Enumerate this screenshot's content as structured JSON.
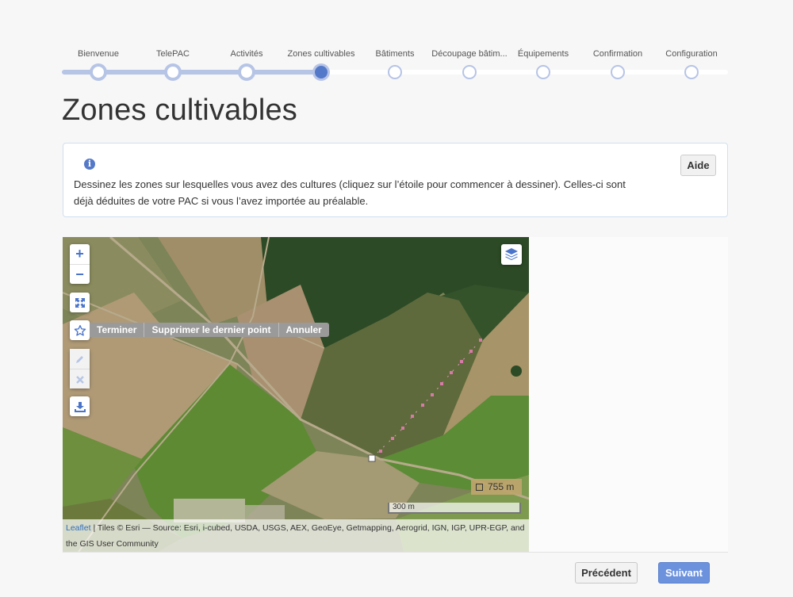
{
  "stepper": {
    "steps": [
      {
        "label": "Bienvenue",
        "state": "done"
      },
      {
        "label": "TelePAC",
        "state": "done"
      },
      {
        "label": "Activités",
        "state": "done"
      },
      {
        "label": "Zones cultivables",
        "state": "current"
      },
      {
        "label": "Bâtiments",
        "state": "todo"
      },
      {
        "label": "Découpage bâtim...",
        "state": "todo"
      },
      {
        "label": "Équipements",
        "state": "todo"
      },
      {
        "label": "Confirmation",
        "state": "todo"
      },
      {
        "label": "Configuration",
        "state": "todo"
      }
    ]
  },
  "page": {
    "title": "Zones cultivables"
  },
  "info": {
    "icon": "info-icon",
    "text": "Dessinez les zones sur lesquelles vous avez des cultures (cliquez sur l’étoile pour commencer à dessiner). Celles-ci sont déjà déduites de votre PAC si vous l’avez importée au préalable.",
    "help_label": "Aide"
  },
  "map": {
    "zoom_in": "+",
    "zoom_out": "−",
    "fullscreen_icon": "fullscreen-icon",
    "draw_icon": "star-icon",
    "edit_icon": "pencil-icon",
    "delete_icon": "cross-icon",
    "download_icon": "download-icon",
    "layers_icon": "layers-icon",
    "draw_actions": {
      "finish": "Terminer",
      "delete_last": "Supprimer le dernier point",
      "cancel": "Annuler"
    },
    "measure": "755 m",
    "scale": "300 m",
    "attribution_link": "Leaflet",
    "attribution_text": " | Tiles © Esri — Source: Esri, i-cubed, USDA, USGS, AEX, GeoEye, Getmapping, Aerogrid, IGN, IGP, UPR-EGP, and the GIS User Community"
  },
  "footer": {
    "prev_label": "Précédent",
    "next_label": "Suivant"
  },
  "colors": {
    "accent": "#5579c9",
    "next_button": "#6c92de",
    "step_done": "#b6c4e6"
  }
}
